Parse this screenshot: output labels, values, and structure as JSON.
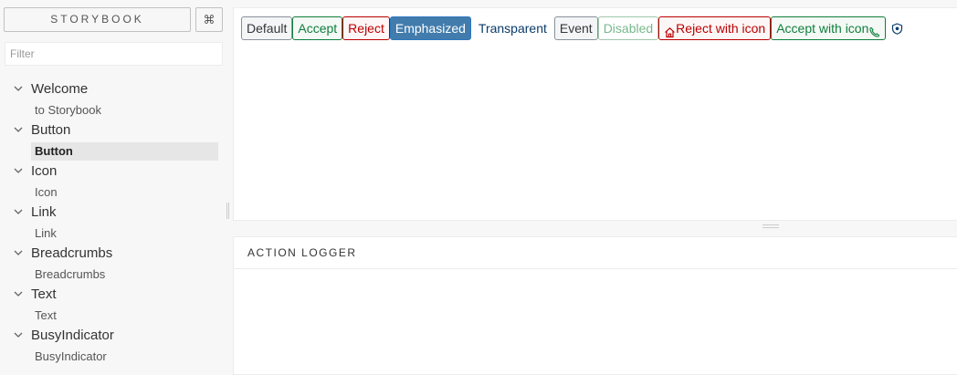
{
  "header": {
    "brand": "STORYBOOK",
    "shortcut_icon": "command-icon",
    "shortcut_glyph": "⌘"
  },
  "filter": {
    "placeholder": "Filter",
    "value": ""
  },
  "tree": {
    "kinds": [
      {
        "label": "Welcome",
        "stories": [
          "to Storybook"
        ]
      },
      {
        "label": "Button",
        "stories": [
          "Button"
        ]
      },
      {
        "label": "Icon",
        "stories": [
          "Icon"
        ]
      },
      {
        "label": "Link",
        "stories": [
          "Link"
        ]
      },
      {
        "label": "Breadcrumbs",
        "stories": [
          "Breadcrumbs"
        ]
      },
      {
        "label": "Text",
        "stories": [
          "Text"
        ]
      },
      {
        "label": "BusyIndicator",
        "stories": [
          "BusyIndicator"
        ]
      }
    ],
    "selected": "Button/Button"
  },
  "preview": {
    "buttons": {
      "default": "Default",
      "accept": "Accept",
      "reject": "Reject",
      "emphasized": "Emphasized",
      "transparent": "Transparent",
      "event": "Event",
      "disabled": "Disabled",
      "reject_with_icon": "Reject with icon",
      "accept_with_icon": "Accept with icon",
      "icon_only": "shield-icon"
    }
  },
  "logger": {
    "title": "ACTION LOGGER"
  },
  "colors": {
    "accept": "#107e3e",
    "reject": "#bb0000",
    "emphasized": "#427cac",
    "transparent_text": "#0a3b6b"
  }
}
